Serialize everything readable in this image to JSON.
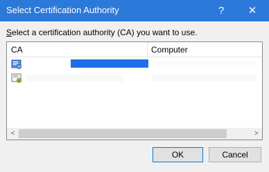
{
  "window": {
    "title": "Select Certification Authority",
    "help_label": "?",
    "close_label": "✕"
  },
  "prompt": {
    "lead": "S",
    "text": "elect a certification authority (CA) you want to use."
  },
  "list": {
    "columns": [
      "CA",
      "Computer"
    ]
  },
  "scrollbar": {
    "left_arrow": "<",
    "right_arrow": ">"
  },
  "buttons": {
    "ok": "OK",
    "cancel": "Cancel"
  },
  "colors": {
    "titlebar": "#2b79d8",
    "selection": "#1e6fe8"
  }
}
